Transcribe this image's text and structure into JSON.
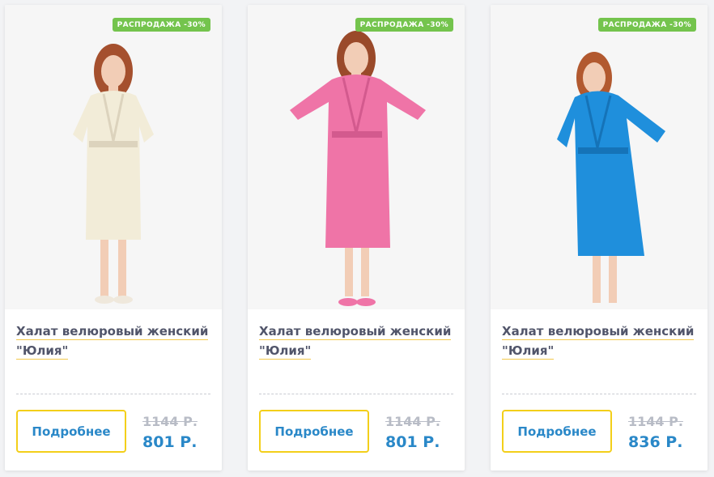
{
  "products": [
    {
      "badge": "РАСПРОДАЖА -30%",
      "title_line1": "Халат велюровый женский",
      "title_line2": "\"Юлия\"",
      "button_label": "Подробнее",
      "old_price": "1144 Р.",
      "new_price": "801 Р.",
      "robe_color": "#f2ecd8",
      "robe_shade": "#dcd3bd"
    },
    {
      "badge": "РАСПРОДАЖА -30%",
      "title_line1": "Халат велюровый женский",
      "title_line2": "\"Юлия\"",
      "button_label": "Подробнее",
      "old_price": "1144 Р.",
      "new_price": "801 Р.",
      "robe_color": "#ef74a7",
      "robe_shade": "#d35a8e"
    },
    {
      "badge": "РАСПРОДАЖА -30%",
      "title_line1": "Халат велюровый женский",
      "title_line2": "\"Юлия\"",
      "button_label": "Подробнее",
      "old_price": "1144 Р.",
      "new_price": "836 Р.",
      "robe_color": "#1f8fdc",
      "robe_shade": "#1573b8"
    }
  ]
}
